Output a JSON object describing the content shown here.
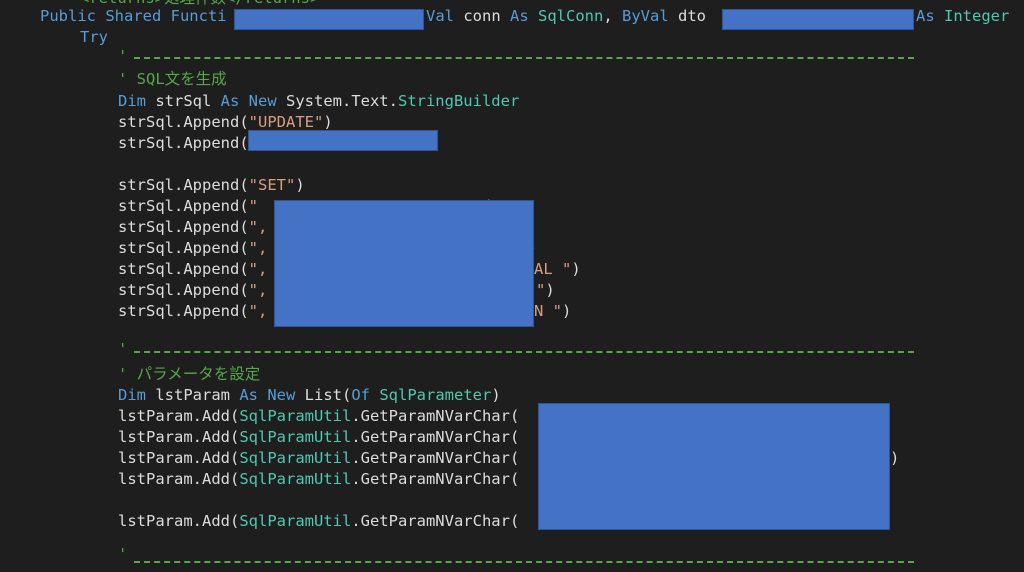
{
  "code": {
    "l0": {
      "text": "<returns>処理件数</returns>"
    },
    "l1": {
      "kw1": "Public Shared Functi",
      "mid1": "Val",
      "plain1": " conn ",
      "kw2": "As",
      "ty1": " SqlConn",
      "plain2": ", ",
      "kw3": "ByVal",
      "plain3": " dto",
      "kw4": "As",
      "ty2": " Integer"
    },
    "l2": {
      "kw": "Try"
    },
    "sep_comment": "'",
    "c1": "' SQL文を生成",
    "l4": {
      "kw1": "Dim",
      "plain1": " strSql ",
      "kw2": "As",
      "kw3": " New",
      "plain2": " System.Text.",
      "ty": "StringBuilder"
    },
    "append1": {
      "pre": "strSql.Append(",
      "str": "\"UPDATE\"",
      "post": ")"
    },
    "append2": {
      "pre": "strSql.Append(",
      "post": ")"
    },
    "append3": {
      "pre": "strSql.Append(",
      "str": "\"SET\"",
      "post": ")"
    },
    "append4": {
      "pre": "strSql.Append(",
      "str": "\"",
      "post": "\")"
    },
    "append5": {
      "pre": "strSql.Append(",
      "str": "\","
    },
    "append6": {
      "pre": "strSql.Append(",
      "str": "\",",
      "post": ")"
    },
    "append7": {
      "pre": "strSql.Append(",
      "str": "\",",
      "tail": "AL \"",
      "post": ")"
    },
    "append8": {
      "pre": "strSql.Append(",
      "str": "\",",
      "tail": "\"",
      "post": ")"
    },
    "append9": {
      "pre": "strSql.Append(",
      "str": "\",",
      "tail": "N \"",
      "post": ")"
    },
    "c2": "' パラメータを設定",
    "l_list": {
      "kw1": "Dim",
      "plain1": " lstParam ",
      "kw2": "As",
      "kw3": " New",
      "plain2": " List(",
      "kw4": "Of",
      "ty": " SqlParameter",
      "plain3": ")"
    },
    "param": {
      "pre": "lstParam.Add(",
      "ty": "SqlParamUtil",
      "post": ".GetParamNVarChar("
    },
    "param_close": ")"
  }
}
